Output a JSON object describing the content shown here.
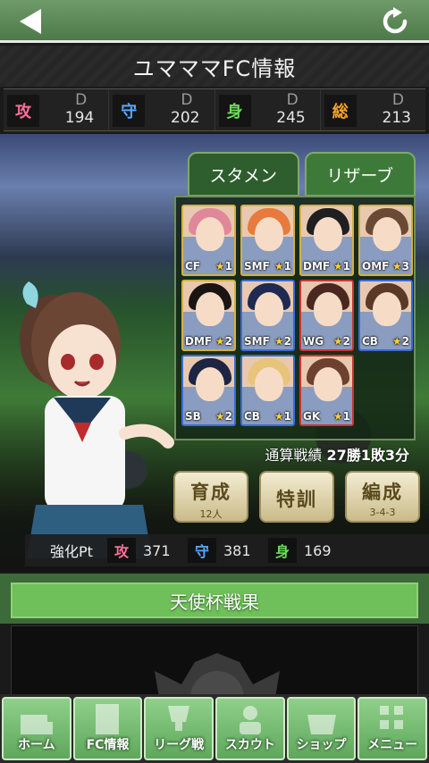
{
  "title": "ユマママFC情報",
  "stats": [
    {
      "label": "攻",
      "grade": "D",
      "value": "194",
      "color": "#ff6f9a"
    },
    {
      "label": "守",
      "grade": "D",
      "value": "202",
      "color": "#5aa7ff"
    },
    {
      "label": "身",
      "grade": "D",
      "value": "245",
      "color": "#6ddb5c"
    },
    {
      "label": "総",
      "grade": "D",
      "value": "213",
      "color": "#f6a623"
    }
  ],
  "tabs": {
    "starters": "スタメン",
    "reserve": "リザーブ"
  },
  "cards": [
    {
      "pos": "CF",
      "stars": "1",
      "border": "gold",
      "hair": "#e0889a"
    },
    {
      "pos": "SMF",
      "stars": "1",
      "border": "gold",
      "hair": "#e77a3c"
    },
    {
      "pos": "DMF",
      "stars": "1",
      "border": "gold",
      "hair": "#1f1f22"
    },
    {
      "pos": "OMF",
      "stars": "3",
      "border": "gold",
      "hair": "#6a4a34"
    },
    {
      "pos": "DMF",
      "stars": "2",
      "border": "gold",
      "hair": "#1a1512"
    },
    {
      "pos": "SMF",
      "stars": "2",
      "border": "blue",
      "hair": "#1e2a52"
    },
    {
      "pos": "WG",
      "stars": "2",
      "border": "red",
      "hair": "#4a2820"
    },
    {
      "pos": "CB",
      "stars": "2",
      "border": "blue",
      "hair": "#5a3a26"
    },
    {
      "pos": "SB",
      "stars": "2",
      "border": "blue",
      "hair": "#1e2444"
    },
    {
      "pos": "CB",
      "stars": "1",
      "border": "blue",
      "hair": "#e8c47a"
    },
    {
      "pos": "GK",
      "stars": "1",
      "border": "red",
      "hair": "#6e4030"
    }
  ],
  "record": {
    "label": "通算戦績",
    "value": "27勝1敗3分"
  },
  "actions": [
    {
      "label": "育成",
      "sub": "12人"
    },
    {
      "label": "特訓",
      "sub": ""
    },
    {
      "label": "編成",
      "sub": "3-4-3"
    }
  ],
  "points": {
    "label": "強化Pt",
    "attack_label": "攻",
    "attack": "371",
    "defense_label": "守",
    "defense": "381",
    "body_label": "身",
    "body": "169"
  },
  "tenshi_cup": "天使杯戦果",
  "nav": [
    {
      "label": "ホーム",
      "icon": "stadium-icon"
    },
    {
      "label": "FC情報",
      "icon": "document-icon"
    },
    {
      "label": "リーグ戦",
      "icon": "trophy-icon"
    },
    {
      "label": "スカウト",
      "icon": "scout-icon"
    },
    {
      "label": "ショップ",
      "icon": "basket-icon"
    },
    {
      "label": "メニュー",
      "icon": "grid-icon"
    }
  ]
}
